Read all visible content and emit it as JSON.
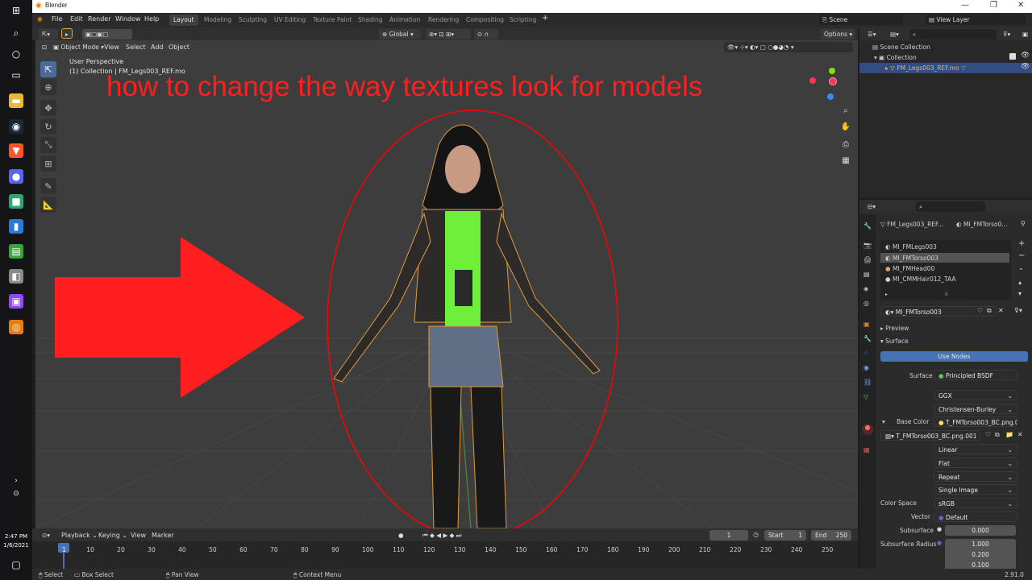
{
  "taskbar": {
    "time": "2:47 PM",
    "date": "1/6/2021",
    "icons": [
      "windows-icon",
      "search-icon",
      "cortana-icon",
      "task-view-icon",
      "file-explorer-icon",
      "steam-icon",
      "brave-icon",
      "discord-icon",
      "app-icon",
      "phone-icon",
      "notepad-icon",
      "app2-icon",
      "twitch-icon",
      "blender-icon"
    ]
  },
  "window": {
    "title": "Blender"
  },
  "menu": {
    "file": "File",
    "edit": "Edit",
    "render": "Render",
    "window": "Window",
    "help": "Help"
  },
  "workspaces": [
    "Layout",
    "Modeling",
    "Sculpting",
    "UV Editing",
    "Texture Paint",
    "Shading",
    "Animation",
    "Rendering",
    "Compositing",
    "Scripting"
  ],
  "scene": {
    "scene_name": "Scene",
    "view_layer": "View Layer"
  },
  "viewport_header": {
    "mode": "Object Mode",
    "view": "View",
    "select": "Select",
    "add": "Add",
    "object": "Object",
    "transform_orientation": "Global",
    "options": "Options"
  },
  "viewport": {
    "perspective": "User Perspective",
    "collection_info": "(1) Collection | FM_Legs003_REF.mo",
    "overlay_text": "how to change the way textures look for models",
    "annotation_color": "#ff0000"
  },
  "outliner": {
    "scene_collection": "Scene Collection",
    "collection": "Collection",
    "object": "FM_Legs003_REF.mo"
  },
  "properties": {
    "breadcrumb_object": "FM_Legs003_REF...",
    "breadcrumb_material": "MI_FMTorso0...",
    "slots": [
      "MI_FMLegs003",
      "MI_FMTorso003",
      "MI_FMHead00",
      "MI_CMMHair012_TAA"
    ],
    "selected_slot": "MI_FMTorso003",
    "material_name": "MI_FMTorso003",
    "preview": "Preview",
    "surface_panel": "Surface",
    "use_nodes": "Use Nodes",
    "surface_label": "Surface",
    "surface_value": "Principled BSDF",
    "distribution": "GGX",
    "subsurface_method": "Christensen-Burley",
    "base_color_label": "Base Color",
    "base_color_value": "T_FMTorso003_BC.png.0...",
    "image_name": "T_FMTorso003_BC.png.001",
    "interpolation": "Linear",
    "projection": "Flat",
    "extension": "Repeat",
    "source": "Single Image",
    "color_space_label": "Color Space",
    "color_space": "sRGB",
    "vector_label": "Vector",
    "vector_value": "Default",
    "subsurface_label": "Subsurface",
    "subsurface_value": "0.000",
    "subsurface_radius_label": "Subsurface Radius",
    "radius": [
      "1.000",
      "0.200",
      "0.100"
    ]
  },
  "timeline": {
    "playback": "Playback",
    "keying": "Keying",
    "view": "View",
    "marker": "Marker",
    "current_frame": "1",
    "start_label": "Start",
    "start": "1",
    "end_label": "End",
    "end": "250",
    "ticks": [
      "1",
      "10",
      "20",
      "30",
      "40",
      "50",
      "60",
      "70",
      "80",
      "90",
      "100",
      "110",
      "120",
      "130",
      "140",
      "150",
      "160",
      "170",
      "180",
      "190",
      "200",
      "210",
      "220",
      "230",
      "240",
      "250"
    ]
  },
  "statusbar": {
    "select": "Select",
    "box_select": "Box Select",
    "pan_view": "Pan View",
    "context_menu": "Context Menu",
    "version": "2.91.0"
  }
}
